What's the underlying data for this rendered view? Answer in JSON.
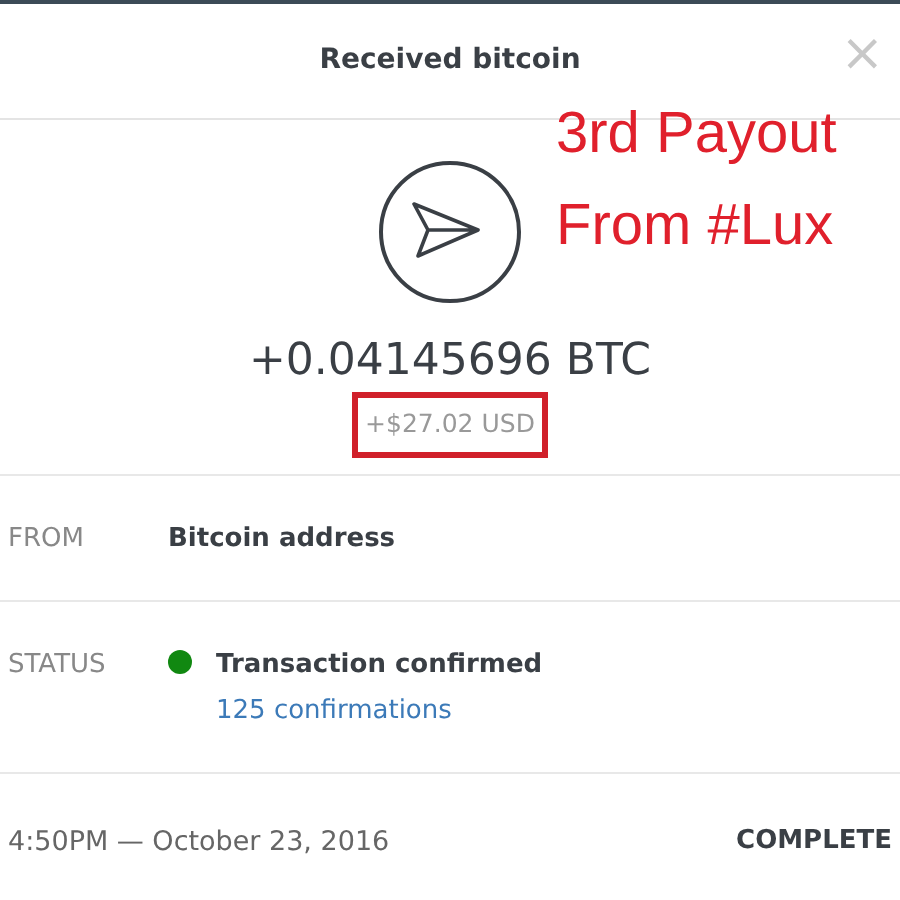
{
  "modal": {
    "title": "Received bitcoin",
    "close": "×"
  },
  "amount": {
    "btc": "+0.04145696 BTC",
    "usd": "+$27.02 USD",
    "usd_highlighted": true
  },
  "details": [
    {
      "kind": "plain",
      "label": "FROM",
      "value": "Bitcoin address"
    },
    {
      "kind": "status",
      "label": "STATUS",
      "value": "Transaction confirmed",
      "color": "#118811",
      "link": "125 confirmations"
    }
  ],
  "footer": {
    "time": "4:50PM — October 23, 2016",
    "state": "COMPLETE"
  },
  "annotation": {
    "lines": [
      "3rd Payout",
      "From #Lux"
    ]
  }
}
